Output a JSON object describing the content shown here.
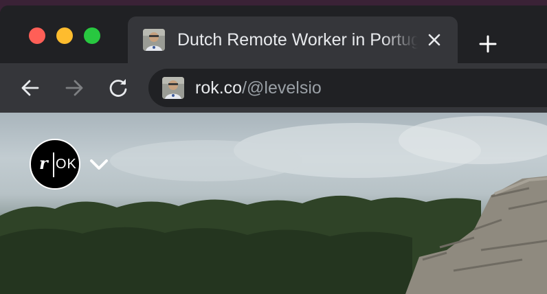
{
  "window": {
    "traffic_lights": {
      "close": "#ff5f57",
      "minimize": "#febc2e",
      "zoom": "#28c840"
    }
  },
  "tab": {
    "title": "Dutch Remote Worker in Portug",
    "favicon": "profile-photo-favicon",
    "close_icon": "close-icon"
  },
  "new_tab_icon": "plus-icon",
  "toolbar": {
    "back_icon": "arrow-left-icon",
    "forward_icon": "arrow-right-icon",
    "reload_icon": "reload-icon"
  },
  "omnibox": {
    "host": "rok.co",
    "path": "/@levelsio",
    "favicon": "profile-photo-favicon"
  },
  "page": {
    "logo": {
      "letter": "r",
      "text": "OK"
    },
    "logo_menu_icon": "chevron-down-icon"
  },
  "colors": {
    "tabstrip_bg": "#202124",
    "active_tab_bg": "#35363a",
    "omnibox_bg": "#202124",
    "text_primary": "#e8eaed",
    "text_secondary": "#9aa0a6"
  }
}
